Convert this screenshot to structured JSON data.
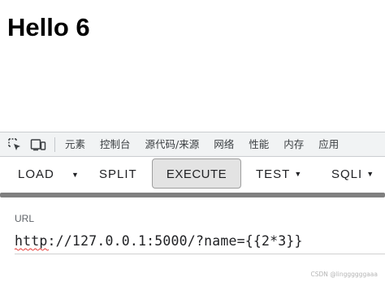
{
  "page": {
    "heading": "Hello 6"
  },
  "devtools": {
    "icons": [
      "element-picker-icon",
      "device-toolbar-icon"
    ],
    "tabs": [
      "元素",
      "控制台",
      "源代码/来源",
      "网络",
      "性能",
      "内存",
      "应用"
    ]
  },
  "hackbar": {
    "buttons": {
      "load": "LOAD",
      "split": "SPLIT",
      "execute": "EXECUTE",
      "test": "TEST",
      "sqli": "SQLI"
    },
    "url_label": "URL",
    "url_value": "http://127.0.0.1:5000/?name={{2*3}}"
  },
  "watermark": "CSDN @linggggggaaa"
}
